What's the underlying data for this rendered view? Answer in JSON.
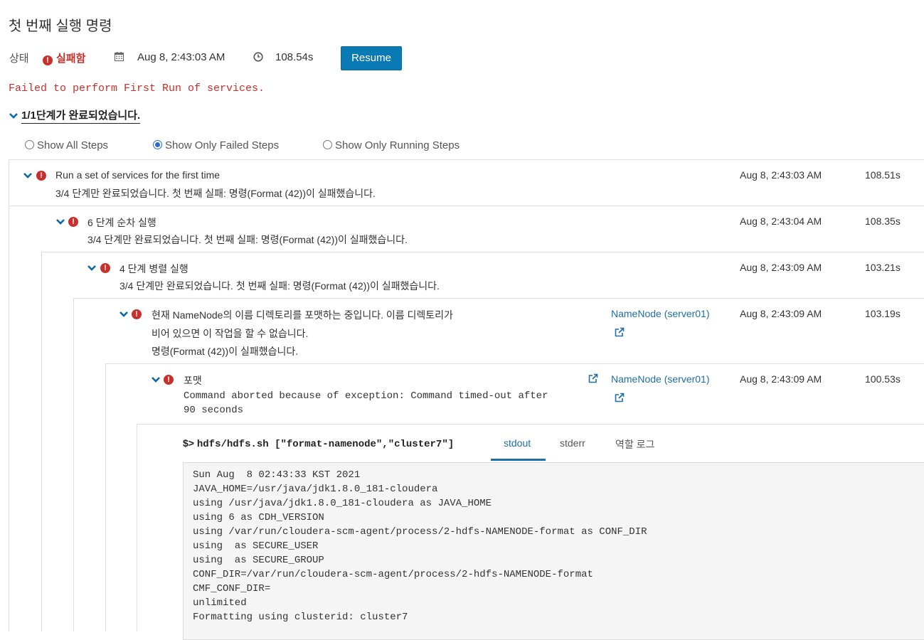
{
  "page": {
    "title": "첫 번째 실행 명령",
    "status_label": "상태",
    "status_value": "실패함",
    "start_time": "Aug 8, 2:43:03 AM",
    "duration": "108.54s",
    "resume_label": "Resume",
    "failure_message": "Failed to perform First Run of services.",
    "summary": "1/1단계가 완료되었습니다."
  },
  "filters": [
    {
      "label": "Show All Steps",
      "selected": false
    },
    {
      "label": "Show Only Failed Steps",
      "selected": true
    },
    {
      "label": "Show Only Running Steps",
      "selected": false
    }
  ],
  "steps": [
    {
      "title": "Run a set of services for the first time",
      "detail": "3/4 단계만 완료되었습니다. 첫 번째 실패: 명령(Format (42))이 실패했습니다.",
      "time": "Aug 8, 2:43:03 AM",
      "duration": "108.51s"
    },
    {
      "title": "6 단계 순차 실행",
      "detail": "3/4 단계만 완료되었습니다. 첫 번째 실패: 명령(Format (42))이 실패했습니다.",
      "time": "Aug 8, 2:43:04 AM",
      "duration": "108.35s"
    },
    {
      "title": "4 단계 병렬 실행",
      "detail": "3/4 단계만 완료되었습니다. 첫 번째 실패: 명령(Format (42))이 실패했습니다.",
      "time": "Aug 8, 2:43:09 AM",
      "duration": "103.21s"
    },
    {
      "title": "현재 NameNode의 이름 디렉토리를 포맷하는 중입니다. 이름 디렉토리가",
      "title2": "비어 있으면 이 작업을 할 수 없습니다.",
      "detail": "명령(Format (42))이 실패했습니다.",
      "role": "NameNode (server01)",
      "time": "Aug 8, 2:43:09 AM",
      "duration": "103.19s"
    },
    {
      "title": "포맷",
      "detail": "Command aborted because of exception: Command timed-out after",
      "detail2": "90 seconds",
      "role": "NameNode (server01)",
      "time": "Aug 8, 2:43:09 AM",
      "duration": "100.53s"
    }
  ],
  "command": {
    "prompt": "$>",
    "text": "hdfs/hdfs.sh [\"format-namenode\",\"cluster7\"]"
  },
  "log_tabs": [
    {
      "label": "stdout",
      "active": true
    },
    {
      "label": "stderr",
      "active": false
    },
    {
      "label": "역할 로그",
      "active": false
    }
  ],
  "log_lines": [
    "Sun Aug  8 02:43:33 KST 2021",
    "JAVA_HOME=/usr/java/jdk1.8.0_181-cloudera",
    "using /usr/java/jdk1.8.0_181-cloudera as JAVA_HOME",
    "using 6 as CDH_VERSION",
    "using /var/run/cloudera-scm-agent/process/2-hdfs-NAMENODE-format as CONF_DIR",
    "using  as SECURE_USER",
    "using  as SECURE_GROUP",
    "CONF_DIR=/var/run/cloudera-scm-agent/process/2-hdfs-NAMENODE-format",
    "CMF_CONF_DIR=",
    "unlimited",
    "Formatting using clusterid: cluster7"
  ],
  "colors": {
    "error": "#c9302c",
    "primary_button": "#0a7ab4",
    "link": "#1f6fa8",
    "chevron": "#0a6aa1"
  }
}
